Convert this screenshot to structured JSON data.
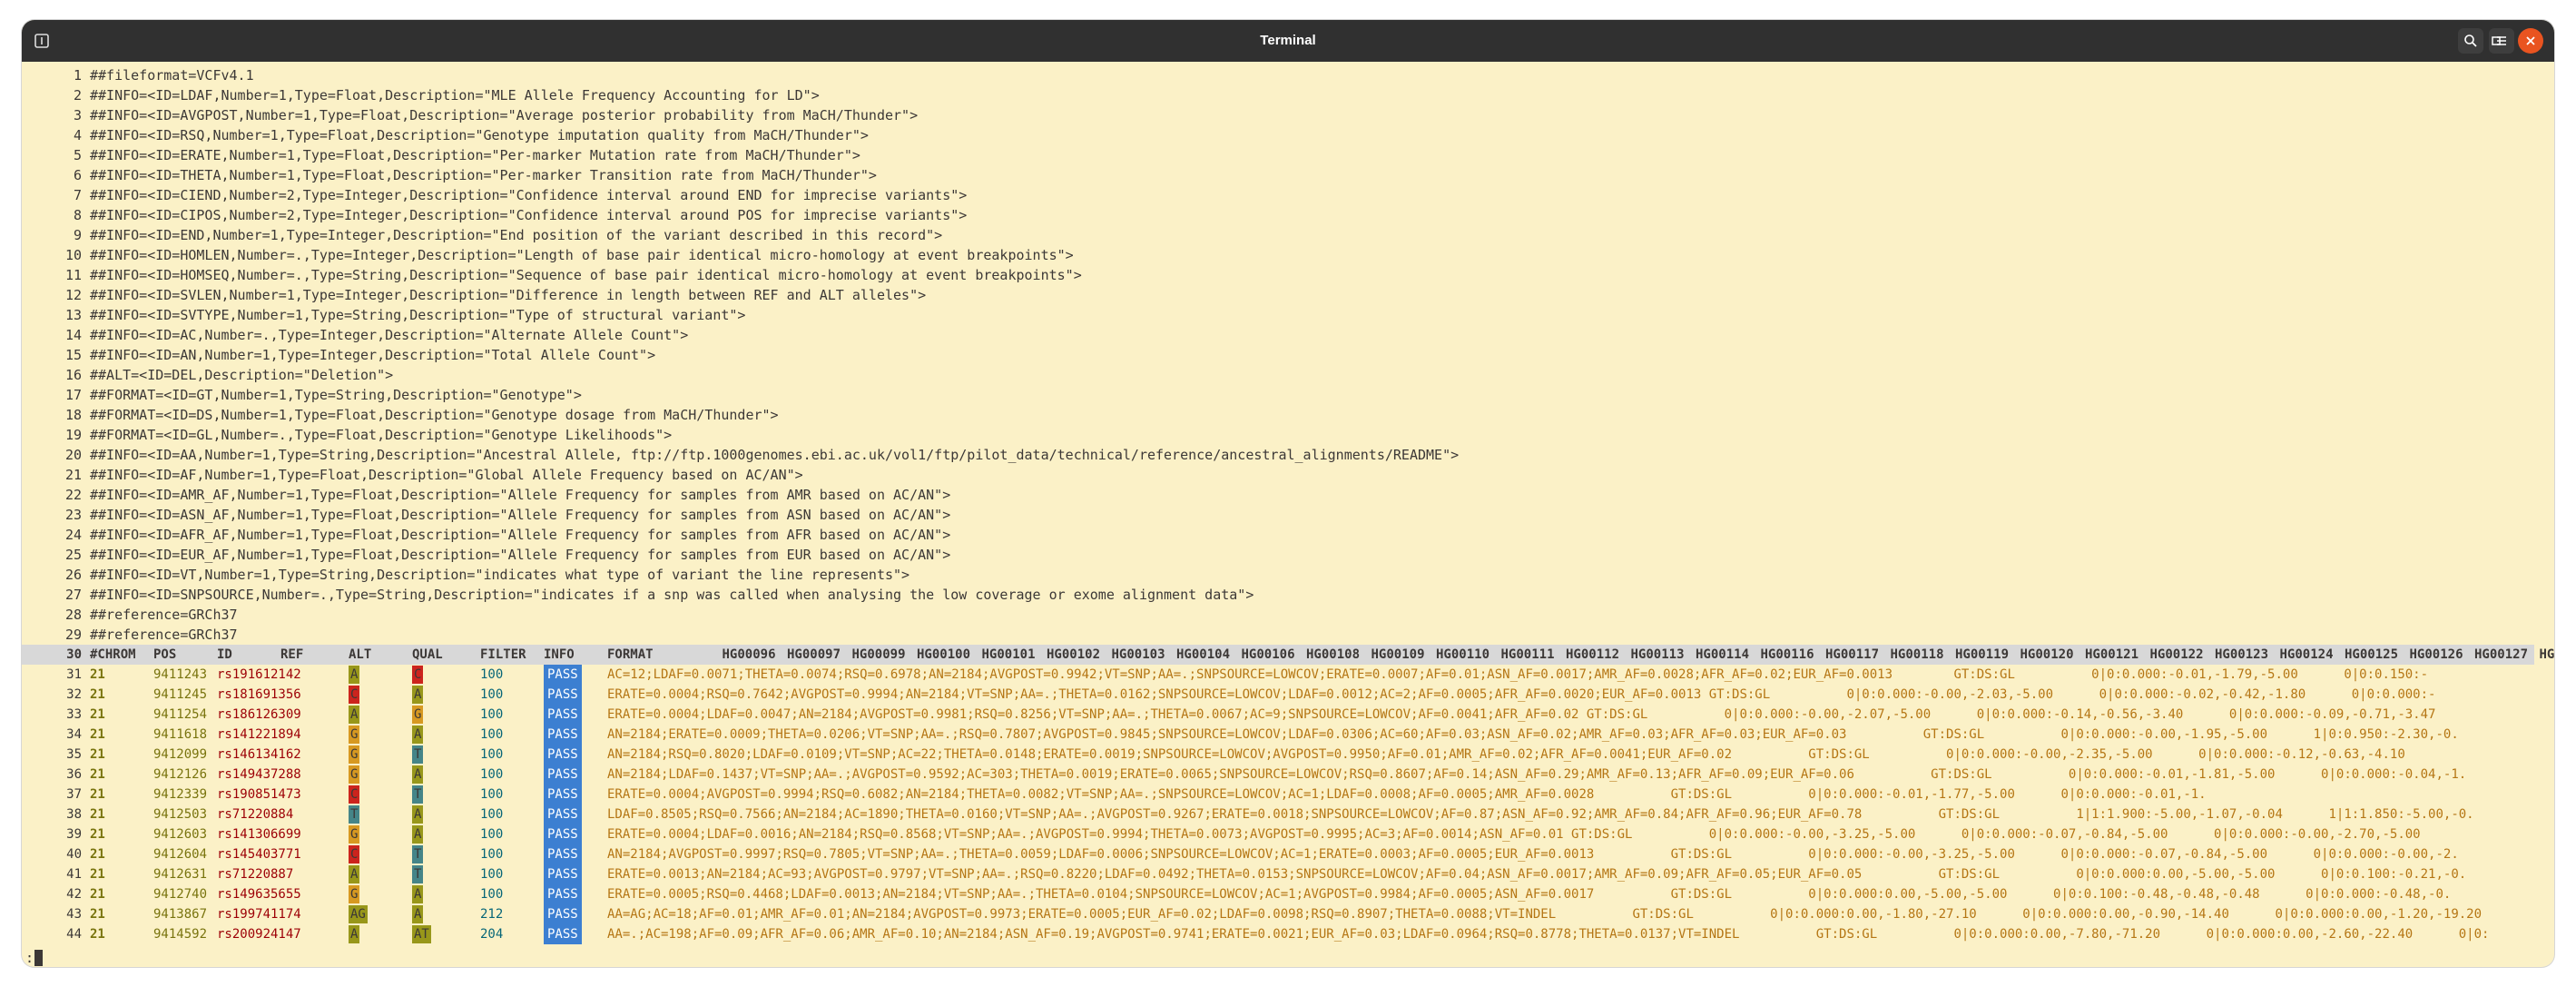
{
  "window": {
    "title": "Terminal"
  },
  "header_lines": [
    {
      "n": "1",
      "t": "##fileformat=VCFv4.1"
    },
    {
      "n": "2",
      "t": "##INFO=<ID=LDAF,Number=1,Type=Float,Description=\"MLE Allele Frequency Accounting for LD\">"
    },
    {
      "n": "3",
      "t": "##INFO=<ID=AVGPOST,Number=1,Type=Float,Description=\"Average posterior probability from MaCH/Thunder\">"
    },
    {
      "n": "4",
      "t": "##INFO=<ID=RSQ,Number=1,Type=Float,Description=\"Genotype imputation quality from MaCH/Thunder\">"
    },
    {
      "n": "5",
      "t": "##INFO=<ID=ERATE,Number=1,Type=Float,Description=\"Per-marker Mutation rate from MaCH/Thunder\">"
    },
    {
      "n": "6",
      "t": "##INFO=<ID=THETA,Number=1,Type=Float,Description=\"Per-marker Transition rate from MaCH/Thunder\">"
    },
    {
      "n": "7",
      "t": "##INFO=<ID=CIEND,Number=2,Type=Integer,Description=\"Confidence interval around END for imprecise variants\">"
    },
    {
      "n": "8",
      "t": "##INFO=<ID=CIPOS,Number=2,Type=Integer,Description=\"Confidence interval around POS for imprecise variants\">"
    },
    {
      "n": "9",
      "t": "##INFO=<ID=END,Number=1,Type=Integer,Description=\"End position of the variant described in this record\">"
    },
    {
      "n": "10",
      "t": "##INFO=<ID=HOMLEN,Number=.,Type=Integer,Description=\"Length of base pair identical micro-homology at event breakpoints\">"
    },
    {
      "n": "11",
      "t": "##INFO=<ID=HOMSEQ,Number=.,Type=String,Description=\"Sequence of base pair identical micro-homology at event breakpoints\">"
    },
    {
      "n": "12",
      "t": "##INFO=<ID=SVLEN,Number=1,Type=Integer,Description=\"Difference in length between REF and ALT alleles\">"
    },
    {
      "n": "13",
      "t": "##INFO=<ID=SVTYPE,Number=1,Type=String,Description=\"Type of structural variant\">"
    },
    {
      "n": "14",
      "t": "##INFO=<ID=AC,Number=.,Type=Integer,Description=\"Alternate Allele Count\">"
    },
    {
      "n": "15",
      "t": "##INFO=<ID=AN,Number=1,Type=Integer,Description=\"Total Allele Count\">"
    },
    {
      "n": "16",
      "t": "##ALT=<ID=DEL,Description=\"Deletion\">"
    },
    {
      "n": "17",
      "t": "##FORMAT=<ID=GT,Number=1,Type=String,Description=\"Genotype\">"
    },
    {
      "n": "18",
      "t": "##FORMAT=<ID=DS,Number=1,Type=Float,Description=\"Genotype dosage from MaCH/Thunder\">"
    },
    {
      "n": "19",
      "t": "##FORMAT=<ID=GL,Number=.,Type=Float,Description=\"Genotype Likelihoods\">"
    },
    {
      "n": "20",
      "t": "##INFO=<ID=AA,Number=1,Type=String,Description=\"Ancestral Allele, ftp://ftp.1000genomes.ebi.ac.uk/vol1/ftp/pilot_data/technical/reference/ancestral_alignments/README\">"
    },
    {
      "n": "21",
      "t": "##INFO=<ID=AF,Number=1,Type=Float,Description=\"Global Allele Frequency based on AC/AN\">"
    },
    {
      "n": "22",
      "t": "##INFO=<ID=AMR_AF,Number=1,Type=Float,Description=\"Allele Frequency for samples from AMR based on AC/AN\">"
    },
    {
      "n": "23",
      "t": "##INFO=<ID=ASN_AF,Number=1,Type=Float,Description=\"Allele Frequency for samples from ASN based on AC/AN\">"
    },
    {
      "n": "24",
      "t": "##INFO=<ID=AFR_AF,Number=1,Type=Float,Description=\"Allele Frequency for samples from AFR based on AC/AN\">"
    },
    {
      "n": "25",
      "t": "##INFO=<ID=EUR_AF,Number=1,Type=Float,Description=\"Allele Frequency for samples from EUR based on AC/AN\">"
    },
    {
      "n": "26",
      "t": "##INFO=<ID=VT,Number=1,Type=String,Description=\"indicates what type of variant the line represents\">"
    },
    {
      "n": "27",
      "t": "##INFO=<ID=SNPSOURCE,Number=.,Type=String,Description=\"indicates if a snp was called when analysing the low coverage or exome alignment data\">"
    },
    {
      "n": "28",
      "t": "##reference=GRCh37"
    },
    {
      "n": "29",
      "t": "##reference=GRCh37"
    }
  ],
  "column_header": {
    "n": "30",
    "cols": [
      "#CHROM",
      "POS",
      "ID",
      "REF",
      "ALT",
      "QUAL",
      "FILTER",
      "INFO",
      "FORMAT",
      "HG00096",
      "HG00097",
      "HG00099",
      "HG00100",
      "HG00101",
      "HG00102",
      "HG00103",
      "HG00104",
      "HG00106",
      "HG00108",
      "HG00109",
      "HG00110",
      "HG00111",
      "HG00112",
      "HG00113",
      "HG00114",
      "HG00116",
      "HG00117",
      "HG00118",
      "HG00119",
      "HG00120",
      "HG00121",
      "HG00122",
      "HG00123",
      "HG00124",
      "HG00125",
      "HG00126",
      "HG00127",
      "HG0"
    ]
  },
  "rows": [
    {
      "n": "31",
      "chrom": "21",
      "pos": "9411243",
      "id": "rs191612142",
      "ref": "A",
      "alt": "C",
      "qual": "100",
      "filter": "PASS",
      "info": "AC=12;LDAF=0.0071;THETA=0.0074;RSQ=0.6978;AN=2184;AVGPOST=0.9942;VT=SNP;AA=.;SNPSOURCE=LOWCOV;ERATE=0.0007;AF=0.01;ASN_AF=0.0017;AMR_AF=0.0028;AFR_AF=0.02;EUR_AF=0.0013        GT:DS:GL          0|0:0.000:-0.01,-1.79,-5.00      0|0:0.150:-"
    },
    {
      "n": "32",
      "chrom": "21",
      "pos": "9411245",
      "id": "rs181691356",
      "ref": "C",
      "alt": "A",
      "qual": "100",
      "filter": "PASS",
      "info": "ERATE=0.0004;RSQ=0.7642;AVGPOST=0.9994;AN=2184;VT=SNP;AA=.;THETA=0.0162;SNPSOURCE=LOWCOV;LDAF=0.0012;AC=2;AF=0.0005;AFR_AF=0.0020;EUR_AF=0.0013 GT:DS:GL          0|0:0.000:-0.00,-2.03,-5.00      0|0:0.000:-0.02,-0.42,-1.80      0|0:0.000:-"
    },
    {
      "n": "33",
      "chrom": "21",
      "pos": "9411254",
      "id": "rs186126309",
      "ref": "A",
      "alt": "G",
      "qual": "100",
      "filter": "PASS",
      "info": "ERATE=0.0004;LDAF=0.0047;AN=2184;AVGPOST=0.9981;RSQ=0.8256;VT=SNP;AA=.;THETA=0.0067;AC=9;SNPSOURCE=LOWCOV;AF=0.0041;AFR_AF=0.02 GT:DS:GL          0|0:0.000:-0.00,-2.07,-5.00      0|0:0.000:-0.14,-0.56,-3.40      0|0:0.000:-0.09,-0.71,-3.47"
    },
    {
      "n": "34",
      "chrom": "21",
      "pos": "9411618",
      "id": "rs141221894",
      "ref": "G",
      "alt": "A",
      "qual": "100",
      "filter": "PASS",
      "info": "AN=2184;ERATE=0.0009;THETA=0.0206;VT=SNP;AA=.;RSQ=0.7807;AVGPOST=0.9845;SNPSOURCE=LOWCOV;LDAF=0.0306;AC=60;AF=0.03;ASN_AF=0.02;AMR_AF=0.03;AFR_AF=0.03;EUR_AF=0.03          GT:DS:GL          0|0:0.000:-0.00,-1.95,-5.00      1|0:0.950:-2.30,-0."
    },
    {
      "n": "35",
      "chrom": "21",
      "pos": "9412099",
      "id": "rs146134162",
      "ref": "G",
      "alt": "T",
      "qual": "100",
      "filter": "PASS",
      "info": "AN=2184;RSQ=0.8020;LDAF=0.0109;VT=SNP;AC=22;THETA=0.0148;ERATE=0.0019;SNPSOURCE=LOWCOV;AVGPOST=0.9950;AF=0.01;AMR_AF=0.02;AFR_AF=0.0041;EUR_AF=0.02          GT:DS:GL          0|0:0.000:-0.00,-2.35,-5.00      0|0:0.000:-0.12,-0.63,-4.10"
    },
    {
      "n": "36",
      "chrom": "21",
      "pos": "9412126",
      "id": "rs149437288",
      "ref": "G",
      "alt": "A",
      "qual": "100",
      "filter": "PASS",
      "info": "AN=2184;LDAF=0.1437;VT=SNP;AA=.;AVGPOST=0.9592;AC=303;THETA=0.0019;ERATE=0.0065;SNPSOURCE=LOWCOV;RSQ=0.8607;AF=0.14;ASN_AF=0.29;AMR_AF=0.13;AFR_AF=0.09;EUR_AF=0.06          GT:DS:GL          0|0:0.000:-0.01,-1.81,-5.00      0|0:0.000:-0.04,-1."
    },
    {
      "n": "37",
      "chrom": "21",
      "pos": "9412339",
      "id": "rs190851473",
      "ref": "C",
      "alt": "T",
      "qual": "100",
      "filter": "PASS",
      "info": "ERATE=0.0004;AVGPOST=0.9994;RSQ=0.6082;AN=2184;THETA=0.0082;VT=SNP;AA=.;SNPSOURCE=LOWCOV;AC=1;LDAF=0.0008;AF=0.0005;AMR_AF=0.0028          GT:DS:GL          0|0:0.000:-0.01,-1.77,-5.00      0|0:0.000:-0.01,-1."
    },
    {
      "n": "38",
      "chrom": "21",
      "pos": "9412503",
      "id": "rs71220884",
      "ref": "T",
      "alt": "A",
      "qual": "100",
      "filter": "PASS",
      "info": "LDAF=0.8505;RSQ=0.7566;AN=2184;AC=1890;THETA=0.0160;VT=SNP;AA=.;AVGPOST=0.9267;ERATE=0.0018;SNPSOURCE=LOWCOV;AF=0.87;ASN_AF=0.92;AMR_AF=0.84;AFR_AF=0.96;EUR_AF=0.78          GT:DS:GL          1|1:1.900:-5.00,-1.07,-0.04      1|1:1.850:-5.00,-0."
    },
    {
      "n": "39",
      "chrom": "21",
      "pos": "9412603",
      "id": "rs141306699",
      "ref": "G",
      "alt": "A",
      "qual": "100",
      "filter": "PASS",
      "info": "ERATE=0.0004;LDAF=0.0016;AN=2184;RSQ=0.8568;VT=SNP;AA=.;AVGPOST=0.9994;THETA=0.0073;AVGPOST=0.9995;AC=3;AF=0.0014;ASN_AF=0.01 GT:DS:GL          0|0:0.000:-0.00,-3.25,-5.00      0|0:0.000:-0.07,-0.84,-5.00      0|0:0.000:-0.00,-2.70,-5.00"
    },
    {
      "n": "40",
      "chrom": "21",
      "pos": "9412604",
      "id": "rs145403771",
      "ref": "C",
      "alt": "T",
      "qual": "100",
      "filter": "PASS",
      "info": "AN=2184;AVGPOST=0.9997;RSQ=0.7805;VT=SNP;AA=.;THETA=0.0059;LDAF=0.0006;SNPSOURCE=LOWCOV;AC=1;ERATE=0.0003;AF=0.0005;EUR_AF=0.0013          GT:DS:GL          0|0:0.000:-0.00,-3.25,-5.00      0|0:0.000:-0.07,-0.84,-5.00      0|0:0.000:-0.00,-2."
    },
    {
      "n": "41",
      "chrom": "21",
      "pos": "9412631",
      "id": "rs71220887",
      "ref": "A",
      "alt": "T",
      "qual": "100",
      "filter": "PASS",
      "info": "ERATE=0.0013;AN=2184;AC=93;AVGPOST=0.9797;VT=SNP;AA=.;RSQ=0.8220;LDAF=0.0492;THETA=0.0153;SNPSOURCE=LOWCOV;AF=0.04;ASN_AF=0.0017;AMR_AF=0.09;AFR_AF=0.05;EUR_AF=0.05          GT:DS:GL          0|0:0.000:0.00,-5.00,-5.00      0|0:0.100:-0.21,-0."
    },
    {
      "n": "42",
      "chrom": "21",
      "pos": "9412740",
      "id": "rs149635655",
      "ref": "G",
      "alt": "A",
      "qual": "100",
      "filter": "PASS",
      "info": "ERATE=0.0005;RSQ=0.4468;LDAF=0.0013;AN=2184;VT=SNP;AA=.;THETA=0.0104;SNPSOURCE=LOWCOV;AC=1;AVGPOST=0.9984;AF=0.0005;ASN_AF=0.0017          GT:DS:GL          0|0:0.000:0.00,-5.00,-5.00      0|0:0.100:-0.48,-0.48,-0.48      0|0:0.000:-0.48,-0."
    },
    {
      "n": "43",
      "chrom": "21",
      "pos": "9413867",
      "id": "rs199741174",
      "ref": "AG",
      "alt": "A",
      "qual": "212",
      "filter": "PASS",
      "info": "AA=AG;AC=18;AF=0.01;AMR_AF=0.01;AN=2184;AVGPOST=0.9973;ERATE=0.0005;EUR_AF=0.02;LDAF=0.0098;RSQ=0.8907;THETA=0.0088;VT=INDEL          GT:DS:GL          0|0:0.000:0.00,-1.80,-27.10      0|0:0.000:0.00,-0.90,-14.40      0|0:0.000:0.00,-1.20,-19.20"
    },
    {
      "n": "44",
      "chrom": "21",
      "pos": "9414592",
      "id": "rs200924147",
      "ref": "A",
      "alt": "AT",
      "qual": "204",
      "filter": "PASS",
      "info": "AA=.;AC=198;AF=0.09;AFR_AF=0.06;AMR_AF=0.10;AN=2184;ASN_AF=0.19;AVGPOST=0.9741;ERATE=0.0021;EUR_AF=0.03;LDAF=0.0964;RSQ=0.8778;THETA=0.0137;VT=INDEL          GT:DS:GL          0|0:0.000:0.00,-7.80,-71.20      0|0:0.000:0.00,-2.60,-22.40      0|0:"
    }
  ],
  "status": {
    "prompt": ":"
  },
  "colors": {
    "bg": "#fbf1c7",
    "titlebar": "#303030",
    "filter_bg": "#3c7fd1",
    "A": "#98971a",
    "C": "#cc241d",
    "G": "#d79921",
    "T": "#458588"
  }
}
